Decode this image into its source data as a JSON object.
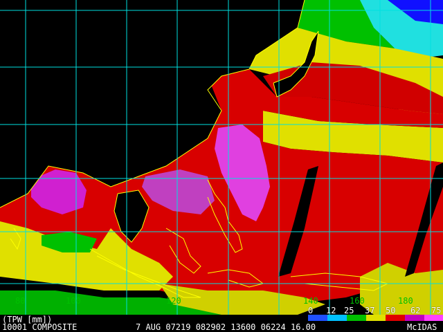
{
  "map": {
    "product": "(TPW [mm])",
    "composite_line": "10001 COMPOSITE",
    "meta_line": "7 AUG 07219 082902 13600 06224 16.00",
    "source": "McIDAS",
    "longitude_labels": [
      "80",
      "100",
      "120",
      "140",
      "160",
      "180"
    ],
    "legend": {
      "values": [
        "0",
        "12",
        "25",
        "37",
        "50",
        "62",
        "75"
      ],
      "colors": [
        "#2050ff",
        "#00c0ff",
        "#00c000",
        "#e0e000",
        "#e00000",
        "#c000c0",
        "#ff40ff"
      ]
    }
  }
}
